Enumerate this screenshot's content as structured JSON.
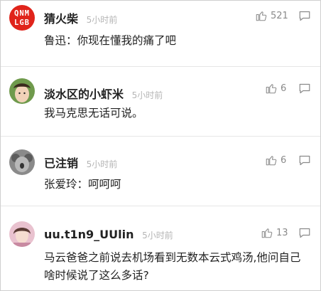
{
  "comments": [
    {
      "username": "猜火柴",
      "time": "5小时前",
      "likes": "521",
      "text": "鲁迅：你现在懂我的痛了吧",
      "avatar_text": [
        "QNM",
        "LGB"
      ],
      "avatar_color": "#e0241b"
    },
    {
      "username": "淡水区的小虾米",
      "time": "5小时前",
      "likes": "6",
      "text": "我马克思无话可说。",
      "avatar_color": "#5a8a3c"
    },
    {
      "username": "已注销",
      "time": "5小时前",
      "likes": "6",
      "text": "张爱玲：呵呵呵",
      "avatar_color": "#6e6e6e"
    },
    {
      "username": "uu.t1n9_UUlin",
      "time": "5小时前",
      "likes": "13",
      "text": "马云爸爸之前说去机场看到无数本云式鸡汤,他问自己啥时候说了这么多话?",
      "avatar_color": "#d9a3b5"
    }
  ],
  "icons": {
    "like": "thumbs-up-icon",
    "reply": "comment-bubble-icon"
  }
}
